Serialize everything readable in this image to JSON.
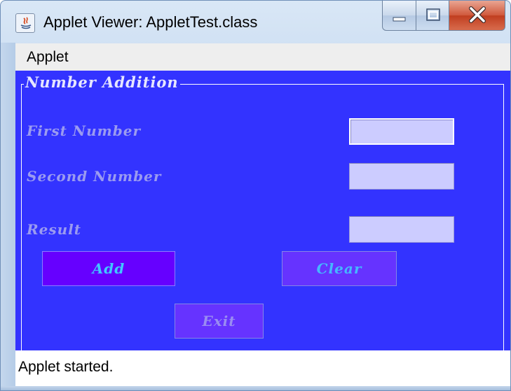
{
  "window": {
    "title": "Applet Viewer: AppletTest.class",
    "icon": "java-applet-icon",
    "controls": [
      "minimize-icon",
      "maximize-icon",
      "close-icon"
    ]
  },
  "menubar": {
    "items": [
      {
        "label": "Applet"
      }
    ]
  },
  "panel": {
    "legend": "Number Addition",
    "first_label": "First Number",
    "first_value": "",
    "second_label": "Second Number",
    "second_value": "",
    "result_label": "Result",
    "result_value": "",
    "buttons": {
      "add": "Add",
      "clear": "Clear",
      "exit": "Exit"
    }
  },
  "status": {
    "text": "Applet started."
  },
  "colors": {
    "panel_background": "#3333ff",
    "field_background": "#ccccff",
    "add_button": "#6600ff",
    "button": "#6633ff",
    "label_text": "#9b9bf0",
    "button_text": "#40c8ff"
  }
}
